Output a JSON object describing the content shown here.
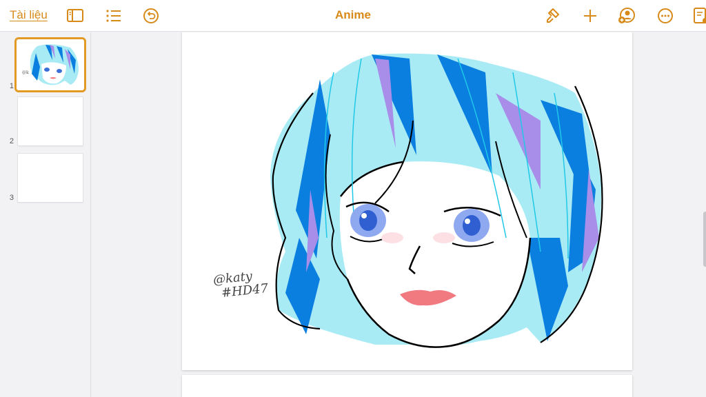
{
  "toolbar": {
    "documents_link": "Tài liệu",
    "title": "Anime",
    "accent": "#d88a18",
    "left_icons": [
      "sidebar-icon",
      "list-icon",
      "undo-icon"
    ],
    "right_icons": [
      "paintbrush-icon",
      "plus-icon",
      "collaborate-icon",
      "more-icon",
      "document-icon"
    ]
  },
  "sidebar": {
    "pages": [
      {
        "number": "1",
        "selected": true
      },
      {
        "number": "2",
        "selected": false
      },
      {
        "number": "3",
        "selected": false
      }
    ],
    "selection_color": "#e39a24"
  },
  "drawing": {
    "signature_line1": "@katy",
    "signature_line2": "#HD47",
    "colors": {
      "hair_light": "#a9ebf5",
      "hair_blue": "#0a7fe0",
      "hair_purple": "#a88ee8",
      "lips": "#f07a80",
      "eyes": "#3a6fd8"
    }
  }
}
